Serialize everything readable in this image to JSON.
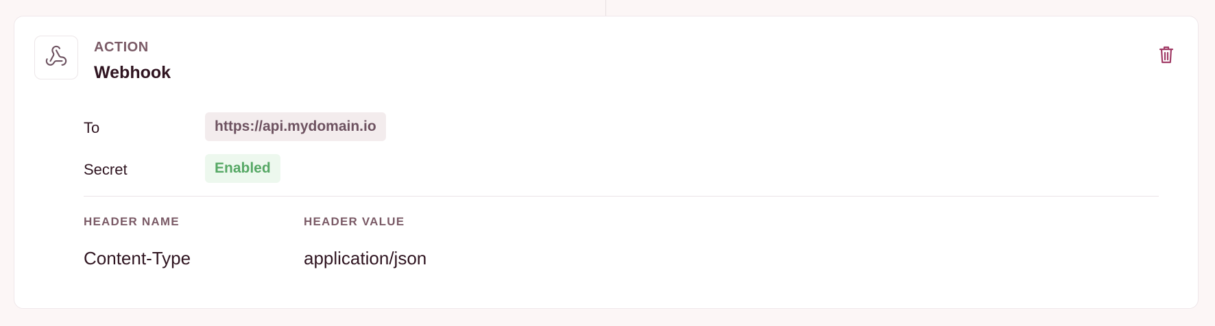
{
  "card": {
    "eyebrow": "ACTION",
    "title": "Webhook",
    "icon": "webhook-icon",
    "delete_icon": "trash-icon"
  },
  "fields": {
    "to_label": "To",
    "to_value": "https://api.mydomain.io",
    "secret_label": "Secret",
    "secret_value": "Enabled"
  },
  "headers_table": {
    "columns": [
      "HEADER NAME",
      "HEADER VALUE"
    ],
    "rows": [
      [
        "Content-Type",
        "application/json"
      ]
    ]
  },
  "colors": {
    "accent": "#a13b66",
    "enabled_text": "#56a865",
    "enabled_bg": "#edf8ee",
    "muted_text": "#7a5a66"
  }
}
